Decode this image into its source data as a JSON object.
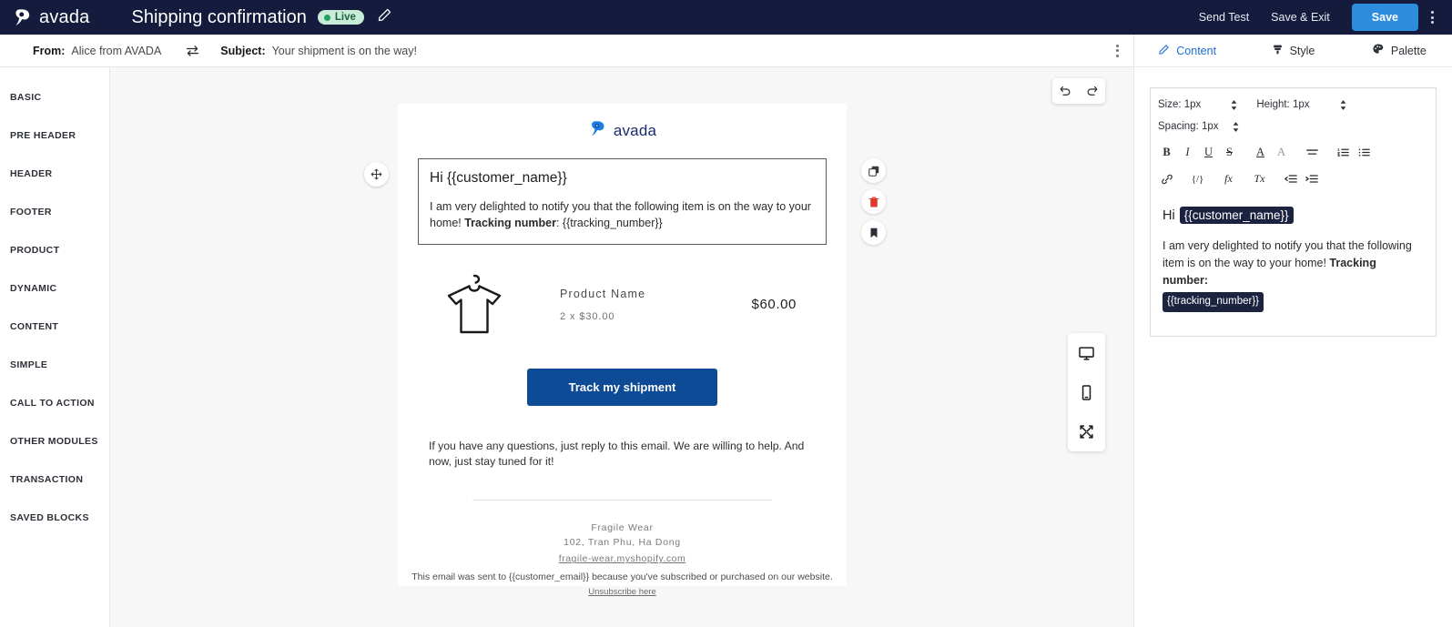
{
  "topbar": {
    "brand": "avada",
    "brand_logo_icon": "avada-logo-icon",
    "title": "Shipping confirmation",
    "status_badge": "Live",
    "edit_icon": "pencil-icon",
    "send_test_label": "Send Test",
    "save_exit_label": "Save & Exit",
    "save_label": "Save",
    "more_icon": "kebab-menu-icon",
    "bg_color": "#141b3d",
    "save_color": "#2c8ddf",
    "badge_bg": "#c9ecd8",
    "badge_dot": "#24a15e"
  },
  "subjectbar": {
    "from_label": "From:",
    "from_value": "Alice from AVADA",
    "swap_icon": "swap-arrows-icon",
    "subject_label": "Subject:",
    "subject_value": "Your shipment is on the way!",
    "more_icon": "kebab-menu-icon"
  },
  "sidebar": {
    "items": [
      {
        "label": "BASIC"
      },
      {
        "label": "PRE HEADER"
      },
      {
        "label": "HEADER"
      },
      {
        "label": "FOOTER"
      },
      {
        "label": "PRODUCT"
      },
      {
        "label": "DYNAMIC"
      },
      {
        "label": "CONTENT"
      },
      {
        "label": "SIMPLE"
      },
      {
        "label": "CALL TO ACTION"
      },
      {
        "label": "OTHER MODULES"
      },
      {
        "label": "TRANSACTION"
      },
      {
        "label": "SAVED BLOCKS"
      }
    ]
  },
  "canvas": {
    "undo_icon": "undo-icon",
    "redo_icon": "redo-icon",
    "devices": [
      {
        "icon": "desktop-icon"
      },
      {
        "icon": "mobile-icon"
      },
      {
        "icon": "fullscreen-icon"
      }
    ],
    "block_actions": [
      {
        "icon": "duplicate-icon"
      },
      {
        "icon": "trash-icon"
      },
      {
        "icon": "bookmark-icon"
      }
    ],
    "drag_icon": "move-handle-icon"
  },
  "email": {
    "logo_text": "avada",
    "logo_icon": "avada-logo-icon",
    "greeting": "Hi {{customer_name}}",
    "body_prefix": "I am very delighted to notify you that the following item is on the way to your home! ",
    "body_bold": "Tracking number",
    "body_suffix": ": {{tracking_number}}",
    "product": {
      "image_icon": "tshirt-hanger-icon",
      "name": "Product Name",
      "qty": "2 x $30.00",
      "price": "$60.00"
    },
    "cta_label": "Track my shipment",
    "cta_color": "#0d4b96",
    "closing": "If you have any questions, just reply to this email. We are willing to help. And now, just stay tuned for it!",
    "address": {
      "company": "Fragile Wear",
      "street": "102, Tran Phu, Ha Dong",
      "site": "fragile-wear.myshopify.com"
    },
    "footer_note": "This email was sent to {{customer_email}} because you've subscribed or purchased on our website.",
    "unsubscribe": "Unsubscribe here"
  },
  "rightpanel": {
    "tabs": [
      {
        "label": "Content",
        "icon": "pencil-icon",
        "active": true
      },
      {
        "label": "Style",
        "icon": "brush-icon",
        "active": false
      },
      {
        "label": "Palette",
        "icon": "palette-icon",
        "active": false
      }
    ],
    "format": {
      "size_label": "Size: 1px",
      "height_label": "Height: 1px",
      "spacing_label": "Spacing: 1px",
      "buttons_row1": [
        {
          "glyph": "B",
          "name": "bold-icon"
        },
        {
          "glyph": "I",
          "name": "italic-icon"
        },
        {
          "glyph": "U",
          "name": "underline-icon"
        },
        {
          "glyph": "S",
          "name": "strikethrough-icon"
        },
        {
          "glyph": "A",
          "name": "text-color-icon"
        },
        {
          "glyph": "A",
          "name": "highlight-color-icon"
        },
        {
          "glyph": "≡",
          "name": "align-icon"
        },
        {
          "glyph": "⒈≡",
          "name": "ordered-list-icon"
        },
        {
          "glyph": "•≡",
          "name": "unordered-list-icon"
        }
      ],
      "buttons_row2": [
        {
          "glyph": "🔗",
          "name": "link-icon"
        },
        {
          "glyph": "{/}",
          "name": "html-code-icon"
        },
        {
          "glyph": "fx",
          "name": "merge-tag-icon"
        },
        {
          "glyph": "Tx",
          "name": "clear-format-icon"
        },
        {
          "glyph": "⇥",
          "name": "indent-increase-icon"
        },
        {
          "glyph": "⇤",
          "name": "indent-decrease-icon"
        }
      ]
    },
    "editor": {
      "greeting_prefix": "Hi",
      "greeting_chip": "{{customer_name}}",
      "body_prefix": "I am very delighted to notify you that the following item is on the way to your home! ",
      "body_bold": "Tracking number:",
      "body_chip": "{{tracking_number}}"
    }
  }
}
